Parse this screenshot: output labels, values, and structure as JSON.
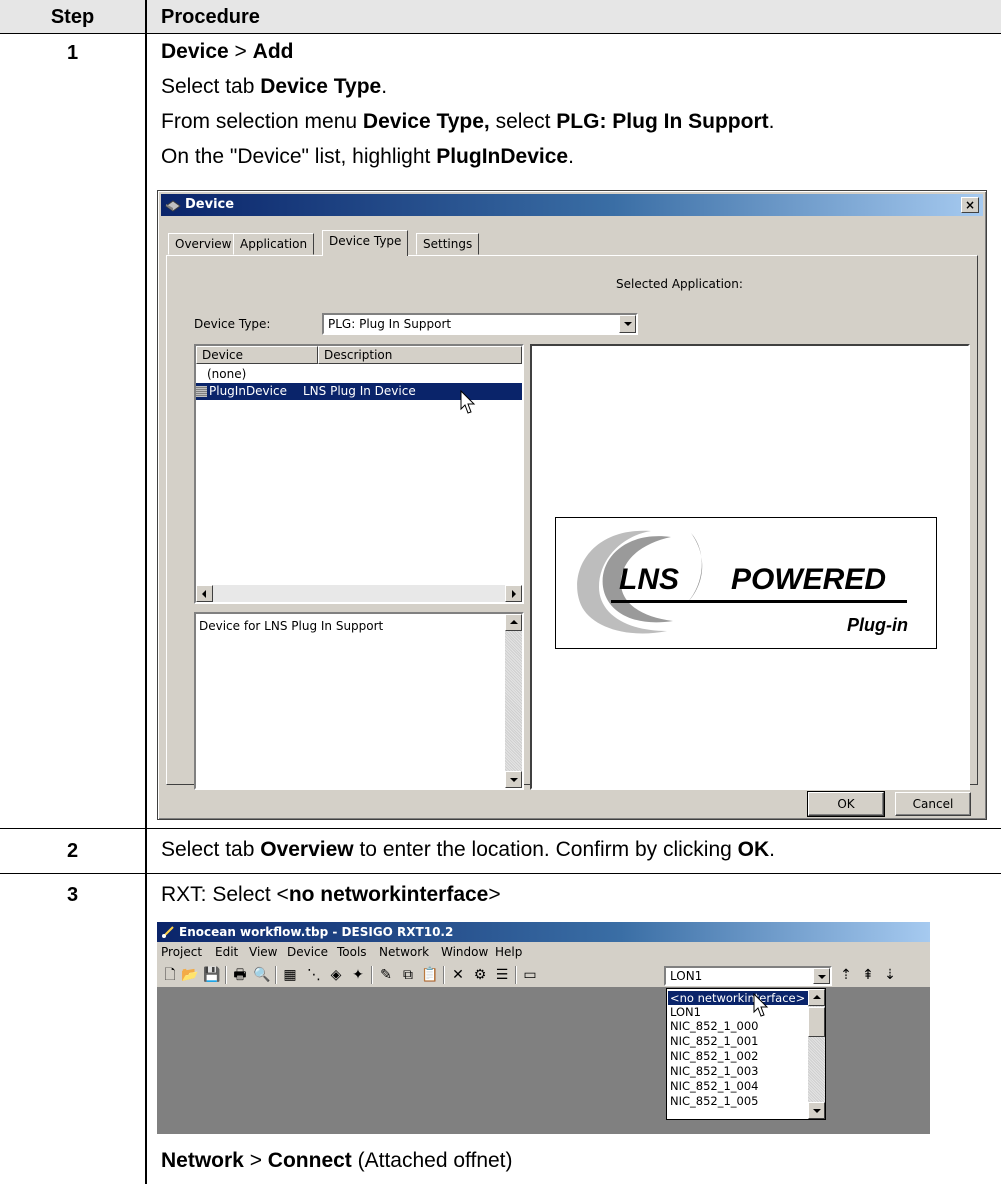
{
  "table": {
    "header": {
      "step": "Step",
      "procedure": "Procedure"
    },
    "steps": [
      {
        "num": "1",
        "lines": [
          {
            "parts": [
              {
                "t": "Device",
                "b": true
              },
              {
                "t": " > ",
                "b": false
              },
              {
                "t": "Add",
                "b": true
              }
            ]
          },
          {
            "parts": [
              {
                "t": "Select tab ",
                "b": false
              },
              {
                "t": "Device Type",
                "b": true
              },
              {
                "t": ".",
                "b": false
              }
            ]
          },
          {
            "parts": [
              {
                "t": "From selection menu ",
                "b": false
              },
              {
                "t": "Device Type,",
                "b": true
              },
              {
                "t": " select ",
                "b": false
              },
              {
                "t": "PLG: Plug In Support",
                "b": true
              },
              {
                "t": ".",
                "b": false
              }
            ]
          },
          {
            "parts": [
              {
                "t": "On the \"Device\" list, highlight ",
                "b": false
              },
              {
                "t": "PlugInDevice",
                "b": true
              },
              {
                "t": ".",
                "b": false
              }
            ]
          }
        ]
      },
      {
        "num": "2",
        "lines": [
          {
            "parts": [
              {
                "t": "Select tab ",
                "b": false
              },
              {
                "t": "Overview",
                "b": true
              },
              {
                "t": " to enter the location. Confirm by clicking ",
                "b": false
              },
              {
                "t": "OK",
                "b": true
              },
              {
                "t": ".",
                "b": false
              }
            ]
          }
        ]
      },
      {
        "num": "3",
        "lines": [
          {
            "parts": [
              {
                "t": "RXT: Select <",
                "b": false
              },
              {
                "t": "no networkinterface",
                "b": true
              },
              {
                "t": ">",
                "b": false
              }
            ]
          },
          {
            "parts": [
              {
                "t": "Network",
                "b": true
              },
              {
                "t": " > ",
                "b": false
              },
              {
                "t": "Connect",
                "b": true
              },
              {
                "t": " (Attached offnet)",
                "b": false
              }
            ]
          }
        ]
      }
    ]
  },
  "device_dialog": {
    "title": "Device",
    "close": "×",
    "tabs": [
      "Overview",
      "Application",
      "Device Type",
      "Settings"
    ],
    "active_tab": "Device Type",
    "selected_application_label": "Selected Application:",
    "device_type_label": "Device Type:",
    "device_type_value": "PLG: Plug In Support",
    "columns": [
      "Device",
      "Description"
    ],
    "rows": [
      {
        "device": "(none)",
        "description": ""
      },
      {
        "device": "PlugInDevice",
        "description": "LNS Plug In Device"
      }
    ],
    "selected_row": 1,
    "description_text": "Device for LNS Plug In Support",
    "logo": {
      "left": "LNS",
      "right": "POWERED",
      "sub": "Plug-in"
    },
    "ok_label": "OK",
    "cancel_label": "Cancel"
  },
  "rxt_window": {
    "title": "Enocean workflow.tbp - DESIGO RXT10.2",
    "menu": [
      "Project",
      "Edit",
      "View",
      "Device",
      "Tools",
      "Network",
      "Window",
      "Help"
    ],
    "combo_value": "LON1",
    "dropdown_items": [
      "<no networkinterface>",
      "LON1",
      "NIC_852_1_000",
      "NIC_852_1_001",
      "NIC_852_1_002",
      "NIC_852_1_003",
      "NIC_852_1_004",
      "NIC_852_1_005"
    ],
    "selected_item": 0
  },
  "colors": {
    "header_bg": "#e6e6e6",
    "win_face": "#d4d0c8",
    "selection": "#0a246a",
    "title_start": "#0a246a"
  }
}
